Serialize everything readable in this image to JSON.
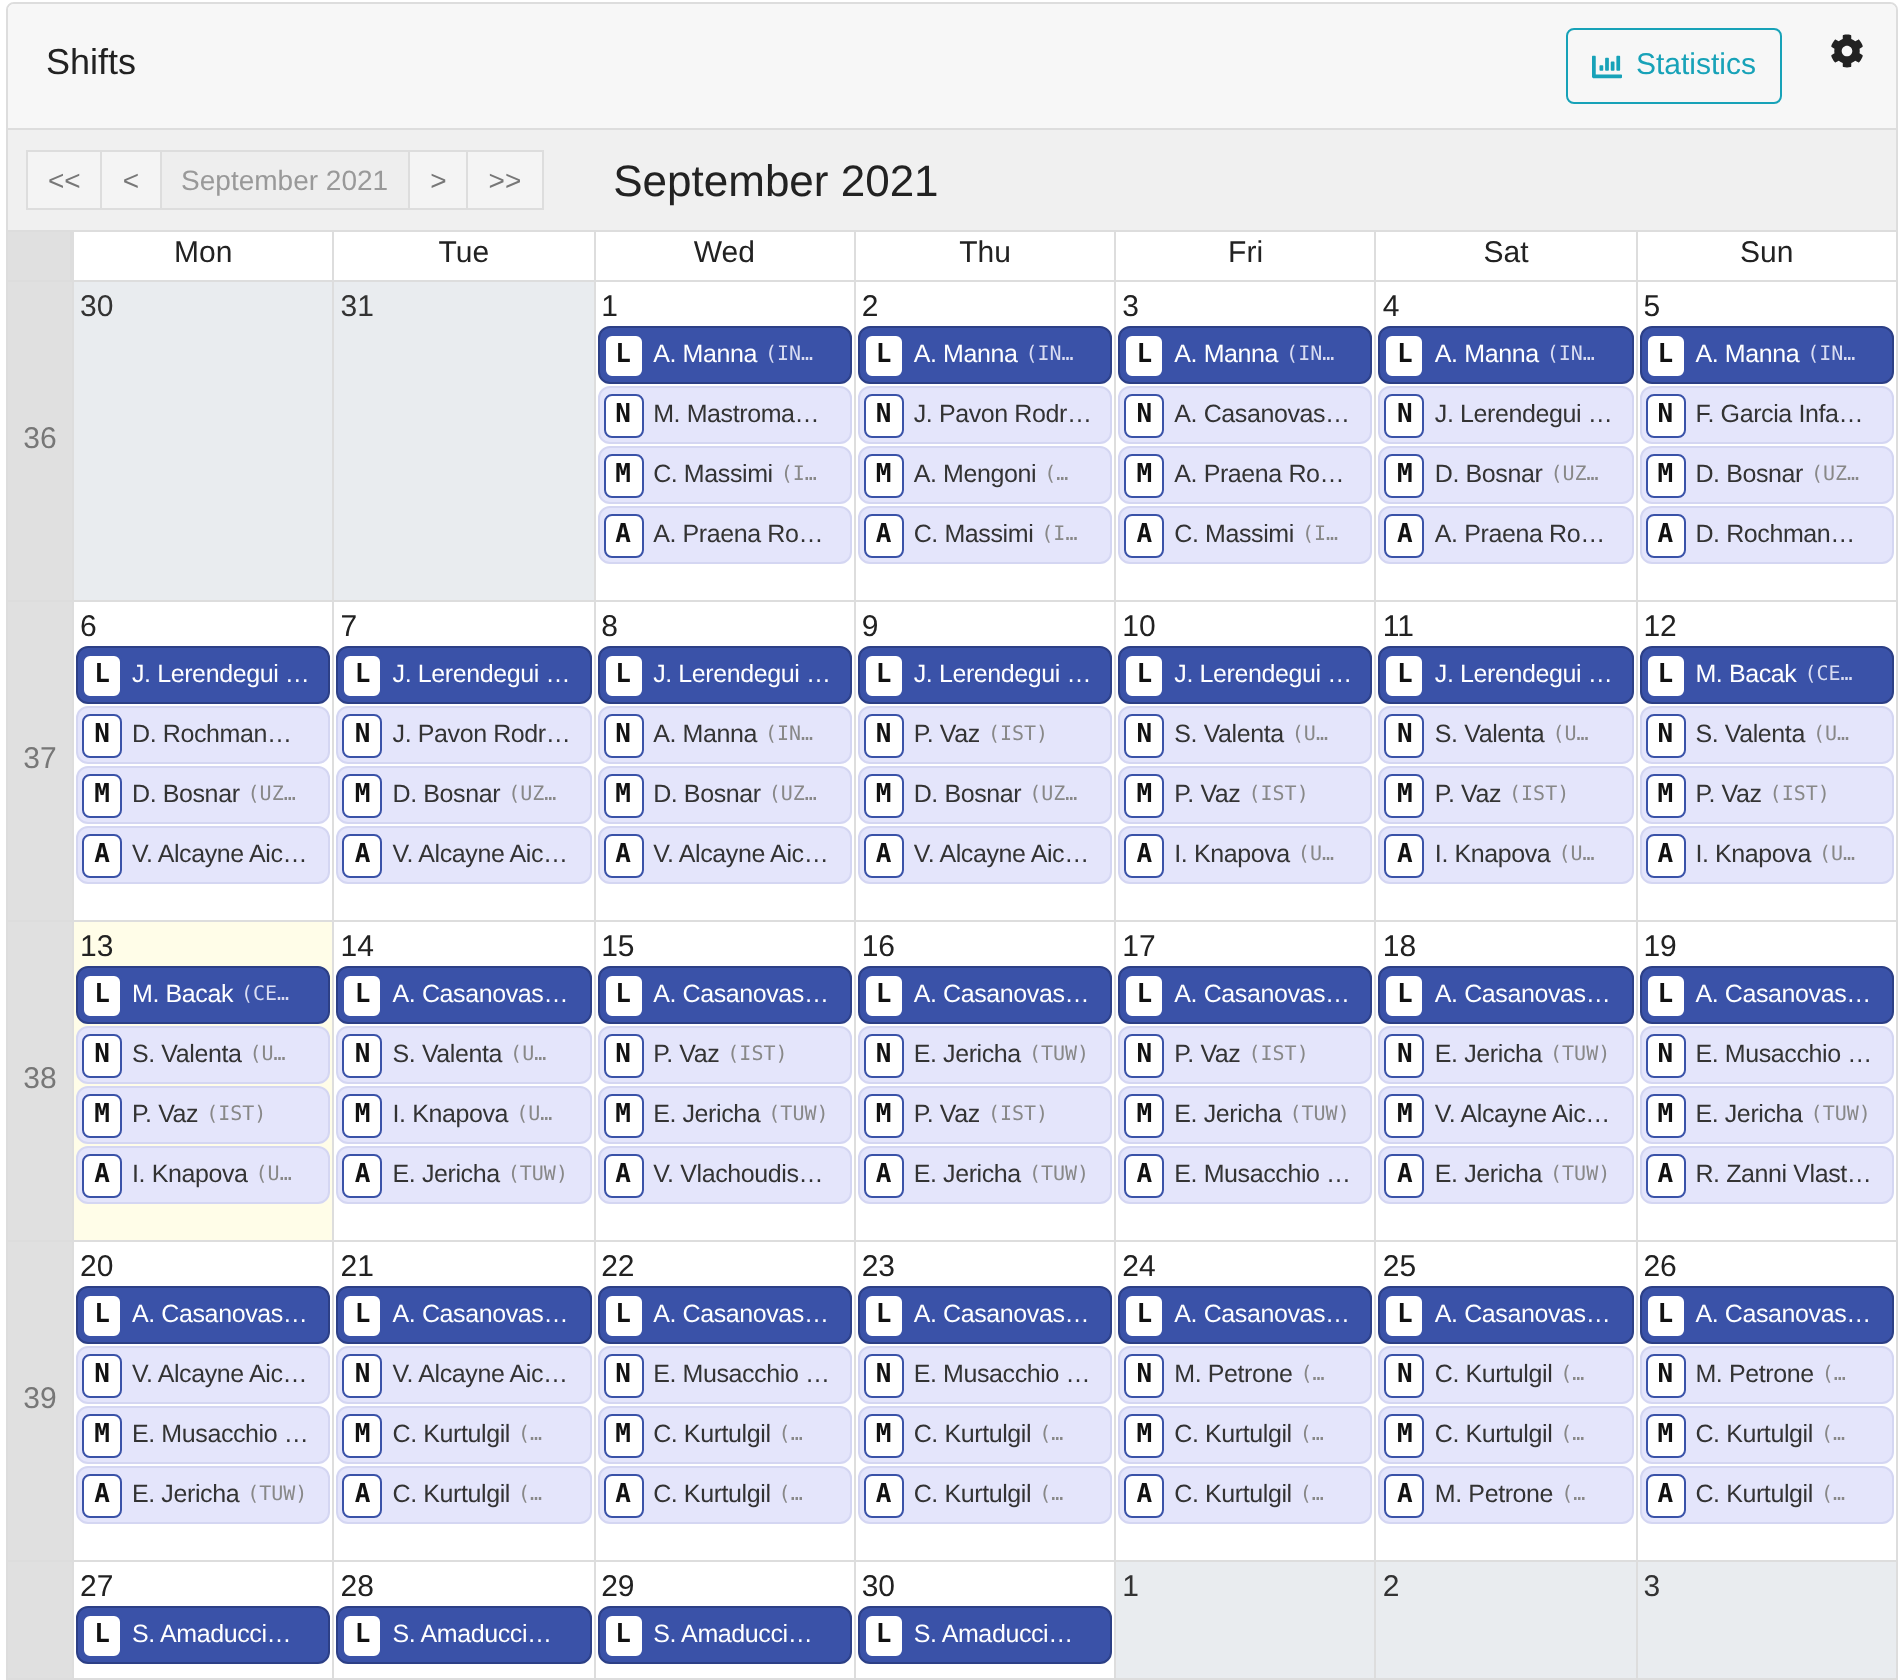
{
  "header": {
    "title": "Shifts",
    "statistics_button": "Statistics"
  },
  "toolbar": {
    "nav_buttons": [
      {
        "label": "<<",
        "disabled": false
      },
      {
        "label": "<",
        "disabled": false
      },
      {
        "label": "September 2021",
        "disabled": true
      },
      {
        "label": ">",
        "disabled": false
      },
      {
        "label": ">>",
        "disabled": false
      }
    ],
    "title": "September 2021"
  },
  "calendar": {
    "columns": [
      "Mon",
      "Tue",
      "Wed",
      "Thu",
      "Fri",
      "Sat",
      "Sun"
    ],
    "weeks": [
      {
        "number": "36",
        "days": [
          {
            "day": "30",
            "outside": true,
            "today": false
          },
          {
            "day": "31",
            "outside": true,
            "today": false
          },
          {
            "day": "1",
            "outside": false,
            "today": false,
            "shifts": [
              {
                "code": "L",
                "name": "A. Manna",
                "org": "(IN…",
                "kind": "primary"
              },
              {
                "code": "N",
                "name": "M. Mastroma…",
                "kind": "secondary"
              },
              {
                "code": "M",
                "name": "C. Massimi",
                "org": "(I…",
                "kind": "secondary"
              },
              {
                "code": "A",
                "name": "A. Praena Ro…",
                "kind": "secondary"
              }
            ]
          },
          {
            "day": "2",
            "outside": false,
            "today": false,
            "shifts": [
              {
                "code": "L",
                "name": "A. Manna",
                "org": "(IN…",
                "kind": "primary"
              },
              {
                "code": "N",
                "name": "J. Pavon Rodr…",
                "kind": "secondary"
              },
              {
                "code": "M",
                "name": "A. Mengoni",
                "org": "(…",
                "kind": "secondary"
              },
              {
                "code": "A",
                "name": "C. Massimi",
                "org": "(I…",
                "kind": "secondary"
              }
            ]
          },
          {
            "day": "3",
            "outside": false,
            "today": false,
            "shifts": [
              {
                "code": "L",
                "name": "A. Manna",
                "org": "(IN…",
                "kind": "primary"
              },
              {
                "code": "N",
                "name": "A. Casanovas…",
                "kind": "secondary"
              },
              {
                "code": "M",
                "name": "A. Praena Ro…",
                "kind": "secondary"
              },
              {
                "code": "A",
                "name": "C. Massimi",
                "org": "(I…",
                "kind": "secondary"
              }
            ]
          },
          {
            "day": "4",
            "outside": false,
            "today": false,
            "shifts": [
              {
                "code": "L",
                "name": "A. Manna",
                "org": "(IN…",
                "kind": "primary"
              },
              {
                "code": "N",
                "name": "J. Lerendegui …",
                "kind": "secondary"
              },
              {
                "code": "M",
                "name": "D. Bosnar",
                "org": "(UZ…",
                "kind": "secondary"
              },
              {
                "code": "A",
                "name": "A. Praena Ro…",
                "kind": "secondary"
              }
            ]
          },
          {
            "day": "5",
            "outside": false,
            "today": false,
            "shifts": [
              {
                "code": "L",
                "name": "A. Manna",
                "org": "(IN…",
                "kind": "primary"
              },
              {
                "code": "N",
                "name": "F. Garcia Infa…",
                "kind": "secondary"
              },
              {
                "code": "M",
                "name": "D. Bosnar",
                "org": "(UZ…",
                "kind": "secondary"
              },
              {
                "code": "A",
                "name": "D. Rochman…",
                "kind": "secondary"
              }
            ]
          }
        ]
      },
      {
        "number": "37",
        "days": [
          {
            "day": "6",
            "outside": false,
            "today": false,
            "shifts": [
              {
                "code": "L",
                "name": "J. Lerendegui …",
                "kind": "primary"
              },
              {
                "code": "N",
                "name": "D. Rochman…",
                "kind": "secondary"
              },
              {
                "code": "M",
                "name": "D. Bosnar",
                "org": "(UZ…",
                "kind": "secondary"
              },
              {
                "code": "A",
                "name": "V. Alcayne Aic…",
                "kind": "secondary"
              }
            ]
          },
          {
            "day": "7",
            "outside": false,
            "today": false,
            "shifts": [
              {
                "code": "L",
                "name": "J. Lerendegui …",
                "kind": "primary"
              },
              {
                "code": "N",
                "name": "J. Pavon Rodr…",
                "kind": "secondary"
              },
              {
                "code": "M",
                "name": "D. Bosnar",
                "org": "(UZ…",
                "kind": "secondary"
              },
              {
                "code": "A",
                "name": "V. Alcayne Aic…",
                "kind": "secondary"
              }
            ]
          },
          {
            "day": "8",
            "outside": false,
            "today": false,
            "shifts": [
              {
                "code": "L",
                "name": "J. Lerendegui …",
                "kind": "primary"
              },
              {
                "code": "N",
                "name": "A. Manna",
                "org": "(IN…",
                "kind": "secondary"
              },
              {
                "code": "M",
                "name": "D. Bosnar",
                "org": "(UZ…",
                "kind": "secondary"
              },
              {
                "code": "A",
                "name": "V. Alcayne Aic…",
                "kind": "secondary"
              }
            ]
          },
          {
            "day": "9",
            "outside": false,
            "today": false,
            "shifts": [
              {
                "code": "L",
                "name": "J. Lerendegui …",
                "kind": "primary"
              },
              {
                "code": "N",
                "name": "P. Vaz",
                "org": "(IST)",
                "kind": "secondary"
              },
              {
                "code": "M",
                "name": "D. Bosnar",
                "org": "(UZ…",
                "kind": "secondary"
              },
              {
                "code": "A",
                "name": "V. Alcayne Aic…",
                "kind": "secondary"
              }
            ]
          },
          {
            "day": "10",
            "outside": false,
            "today": false,
            "shifts": [
              {
                "code": "L",
                "name": "J. Lerendegui …",
                "kind": "primary"
              },
              {
                "code": "N",
                "name": "S. Valenta",
                "org": "(U…",
                "kind": "secondary"
              },
              {
                "code": "M",
                "name": "P. Vaz",
                "org": "(IST)",
                "kind": "secondary"
              },
              {
                "code": "A",
                "name": "I. Knapova",
                "org": "(U…",
                "kind": "secondary"
              }
            ]
          },
          {
            "day": "11",
            "outside": false,
            "today": false,
            "shifts": [
              {
                "code": "L",
                "name": "J. Lerendegui …",
                "kind": "primary"
              },
              {
                "code": "N",
                "name": "S. Valenta",
                "org": "(U…",
                "kind": "secondary"
              },
              {
                "code": "M",
                "name": "P. Vaz",
                "org": "(IST)",
                "kind": "secondary"
              },
              {
                "code": "A",
                "name": "I. Knapova",
                "org": "(U…",
                "kind": "secondary"
              }
            ]
          },
          {
            "day": "12",
            "outside": false,
            "today": false,
            "shifts": [
              {
                "code": "L",
                "name": "M. Bacak",
                "org": "(CE…",
                "kind": "primary"
              },
              {
                "code": "N",
                "name": "S. Valenta",
                "org": "(U…",
                "kind": "secondary"
              },
              {
                "code": "M",
                "name": "P. Vaz",
                "org": "(IST)",
                "kind": "secondary"
              },
              {
                "code": "A",
                "name": "I. Knapova",
                "org": "(U…",
                "kind": "secondary"
              }
            ]
          }
        ]
      },
      {
        "number": "38",
        "days": [
          {
            "day": "13",
            "outside": false,
            "today": true,
            "shifts": [
              {
                "code": "L",
                "name": "M. Bacak",
                "org": "(CE…",
                "kind": "primary"
              },
              {
                "code": "N",
                "name": "S. Valenta",
                "org": "(U…",
                "kind": "secondary"
              },
              {
                "code": "M",
                "name": "P. Vaz",
                "org": "(IST)",
                "kind": "secondary"
              },
              {
                "code": "A",
                "name": "I. Knapova",
                "org": "(U…",
                "kind": "secondary"
              }
            ]
          },
          {
            "day": "14",
            "outside": false,
            "today": false,
            "shifts": [
              {
                "code": "L",
                "name": "A. Casanovas…",
                "kind": "primary"
              },
              {
                "code": "N",
                "name": "S. Valenta",
                "org": "(U…",
                "kind": "secondary"
              },
              {
                "code": "M",
                "name": "I. Knapova",
                "org": "(U…",
                "kind": "secondary"
              },
              {
                "code": "A",
                "name": "E. Jericha",
                "org": "(TUW)",
                "kind": "secondary"
              }
            ]
          },
          {
            "day": "15",
            "outside": false,
            "today": false,
            "shifts": [
              {
                "code": "L",
                "name": "A. Casanovas…",
                "kind": "primary"
              },
              {
                "code": "N",
                "name": "P. Vaz",
                "org": "(IST)",
                "kind": "secondary"
              },
              {
                "code": "M",
                "name": "E. Jericha",
                "org": "(TUW)",
                "kind": "secondary"
              },
              {
                "code": "A",
                "name": "V. Vlachoudis…",
                "kind": "secondary"
              }
            ]
          },
          {
            "day": "16",
            "outside": false,
            "today": false,
            "shifts": [
              {
                "code": "L",
                "name": "A. Casanovas…",
                "kind": "primary"
              },
              {
                "code": "N",
                "name": "E. Jericha",
                "org": "(TUW)",
                "kind": "secondary"
              },
              {
                "code": "M",
                "name": "P. Vaz",
                "org": "(IST)",
                "kind": "secondary"
              },
              {
                "code": "A",
                "name": "E. Jericha",
                "org": "(TUW)",
                "kind": "secondary"
              }
            ]
          },
          {
            "day": "17",
            "outside": false,
            "today": false,
            "shifts": [
              {
                "code": "L",
                "name": "A. Casanovas…",
                "kind": "primary"
              },
              {
                "code": "N",
                "name": "P. Vaz",
                "org": "(IST)",
                "kind": "secondary"
              },
              {
                "code": "M",
                "name": "E. Jericha",
                "org": "(TUW)",
                "kind": "secondary"
              },
              {
                "code": "A",
                "name": "E. Musacchio …",
                "kind": "secondary"
              }
            ]
          },
          {
            "day": "18",
            "outside": false,
            "today": false,
            "shifts": [
              {
                "code": "L",
                "name": "A. Casanovas…",
                "kind": "primary"
              },
              {
                "code": "N",
                "name": "E. Jericha",
                "org": "(TUW)",
                "kind": "secondary"
              },
              {
                "code": "M",
                "name": "V. Alcayne Aic…",
                "kind": "secondary"
              },
              {
                "code": "A",
                "name": "E. Jericha",
                "org": "(TUW)",
                "kind": "secondary"
              }
            ]
          },
          {
            "day": "19",
            "outside": false,
            "today": false,
            "shifts": [
              {
                "code": "L",
                "name": "A. Casanovas…",
                "kind": "primary"
              },
              {
                "code": "N",
                "name": "E. Musacchio …",
                "kind": "secondary"
              },
              {
                "code": "M",
                "name": "E. Jericha",
                "org": "(TUW)",
                "kind": "secondary"
              },
              {
                "code": "A",
                "name": "R. Zanni Vlast…",
                "kind": "secondary"
              }
            ]
          }
        ]
      },
      {
        "number": "39",
        "days": [
          {
            "day": "20",
            "outside": false,
            "today": false,
            "shifts": [
              {
                "code": "L",
                "name": "A. Casanovas…",
                "kind": "primary"
              },
              {
                "code": "N",
                "name": "V. Alcayne Aic…",
                "kind": "secondary"
              },
              {
                "code": "M",
                "name": "E. Musacchio …",
                "kind": "secondary"
              },
              {
                "code": "A",
                "name": "E. Jericha",
                "org": "(TUW)",
                "kind": "secondary"
              }
            ]
          },
          {
            "day": "21",
            "outside": false,
            "today": false,
            "shifts": [
              {
                "code": "L",
                "name": "A. Casanovas…",
                "kind": "primary"
              },
              {
                "code": "N",
                "name": "V. Alcayne Aic…",
                "kind": "secondary"
              },
              {
                "code": "M",
                "name": "C. Kurtulgil",
                "org": "(…",
                "kind": "secondary"
              },
              {
                "code": "A",
                "name": "C. Kurtulgil",
                "org": "(…",
                "kind": "secondary"
              }
            ]
          },
          {
            "day": "22",
            "outside": false,
            "today": false,
            "shifts": [
              {
                "code": "L",
                "name": "A. Casanovas…",
                "kind": "primary"
              },
              {
                "code": "N",
                "name": "E. Musacchio …",
                "kind": "secondary"
              },
              {
                "code": "M",
                "name": "C. Kurtulgil",
                "org": "(…",
                "kind": "secondary"
              },
              {
                "code": "A",
                "name": "C. Kurtulgil",
                "org": "(…",
                "kind": "secondary"
              }
            ]
          },
          {
            "day": "23",
            "outside": false,
            "today": false,
            "shifts": [
              {
                "code": "L",
                "name": "A. Casanovas…",
                "kind": "primary"
              },
              {
                "code": "N",
                "name": "E. Musacchio …",
                "kind": "secondary"
              },
              {
                "code": "M",
                "name": "C. Kurtulgil",
                "org": "(…",
                "kind": "secondary"
              },
              {
                "code": "A",
                "name": "C. Kurtulgil",
                "org": "(…",
                "kind": "secondary"
              }
            ]
          },
          {
            "day": "24",
            "outside": false,
            "today": false,
            "shifts": [
              {
                "code": "L",
                "name": "A. Casanovas…",
                "kind": "primary"
              },
              {
                "code": "N",
                "name": "M. Petrone",
                "org": "(…",
                "kind": "secondary"
              },
              {
                "code": "M",
                "name": "C. Kurtulgil",
                "org": "(…",
                "kind": "secondary"
              },
              {
                "code": "A",
                "name": "C. Kurtulgil",
                "org": "(…",
                "kind": "secondary"
              }
            ]
          },
          {
            "day": "25",
            "outside": false,
            "today": false,
            "shifts": [
              {
                "code": "L",
                "name": "A. Casanovas…",
                "kind": "primary"
              },
              {
                "code": "N",
                "name": "C. Kurtulgil",
                "org": "(…",
                "kind": "secondary"
              },
              {
                "code": "M",
                "name": "C. Kurtulgil",
                "org": "(…",
                "kind": "secondary"
              },
              {
                "code": "A",
                "name": "M. Petrone",
                "org": "(…",
                "kind": "secondary"
              }
            ]
          },
          {
            "day": "26",
            "outside": false,
            "today": false,
            "shifts": [
              {
                "code": "L",
                "name": "A. Casanovas…",
                "kind": "primary"
              },
              {
                "code": "N",
                "name": "M. Petrone",
                "org": "(…",
                "kind": "secondary"
              },
              {
                "code": "M",
                "name": "C. Kurtulgil",
                "org": "(…",
                "kind": "secondary"
              },
              {
                "code": "A",
                "name": "C. Kurtulgil",
                "org": "(…",
                "kind": "secondary"
              }
            ]
          }
        ]
      },
      {
        "days": [
          {
            "day": "27",
            "outside": false,
            "today": false,
            "shifts": [
              {
                "code": "L",
                "name": "S. Amaducci…",
                "kind": "primary"
              }
            ]
          },
          {
            "day": "28",
            "outside": false,
            "today": false,
            "shifts": [
              {
                "code": "L",
                "name": "S. Amaducci…",
                "kind": "primary"
              }
            ]
          },
          {
            "day": "29",
            "outside": false,
            "today": false,
            "shifts": [
              {
                "code": "L",
                "name": "S. Amaducci…",
                "kind": "primary"
              }
            ]
          },
          {
            "day": "30",
            "outside": false,
            "today": false,
            "shifts": [
              {
                "code": "L",
                "name": "S. Amaducci…",
                "kind": "primary"
              }
            ]
          },
          {
            "day": "1",
            "outside": true,
            "today": false
          },
          {
            "day": "2",
            "outside": true,
            "today": false
          },
          {
            "day": "3",
            "outside": true,
            "today": false
          }
        ]
      }
    ]
  }
}
